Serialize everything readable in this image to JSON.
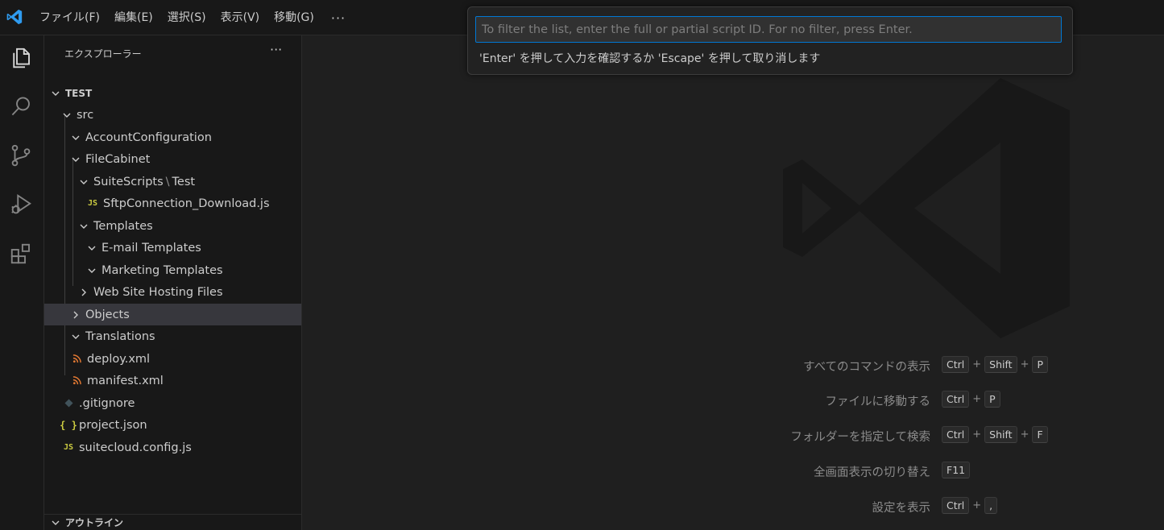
{
  "menu": {
    "items": [
      "ファイル(F)",
      "編集(E)",
      "選択(S)",
      "表示(V)",
      "移動(G)"
    ],
    "more": "···"
  },
  "sidebar": {
    "title": "エクスプローラー",
    "more": "···",
    "outline_title": "アウトライン",
    "tree": [
      {
        "label": "TEST",
        "kind": "root"
      },
      {
        "label": "src",
        "kind": "folder-open"
      },
      {
        "label": "AccountConfiguration",
        "kind": "folder-open"
      },
      {
        "label": "FileCabinet",
        "kind": "folder-open"
      },
      {
        "label": "SuiteScripts",
        "label2": "Test",
        "kind": "folder-open"
      },
      {
        "label": "SftpConnection_Download.js",
        "kind": "file-js",
        "icon_text": "JS"
      },
      {
        "label": "Templates",
        "kind": "folder-open"
      },
      {
        "label": "E-mail Templates",
        "kind": "folder-open"
      },
      {
        "label": "Marketing Templates",
        "kind": "folder-open"
      },
      {
        "label": "Web Site Hosting Files",
        "kind": "folder-closed"
      },
      {
        "label": "Objects",
        "kind": "folder-closed",
        "selected": true
      },
      {
        "label": "Translations",
        "kind": "folder-open"
      },
      {
        "label": "deploy.xml",
        "kind": "file-xml"
      },
      {
        "label": "manifest.xml",
        "kind": "file-xml"
      },
      {
        "label": ".gitignore",
        "kind": "file-git"
      },
      {
        "label": "project.json",
        "kind": "file-json",
        "icon_text": "{ }"
      },
      {
        "label": "suitecloud.config.js",
        "kind": "file-js",
        "icon_text": "JS"
      }
    ]
  },
  "quickinput": {
    "placeholder": "To filter the list, enter the full or partial script ID. For no filter, press Enter.",
    "message": "'Enter' を押して入力を確認するか 'Escape' を押して取り消します"
  },
  "shortcuts": [
    {
      "label": "すべてのコマンドの表示",
      "keys": [
        "Ctrl",
        "Shift",
        "P"
      ]
    },
    {
      "label": "ファイルに移動する",
      "keys": [
        "Ctrl",
        "P"
      ]
    },
    {
      "label": "フォルダーを指定して検索",
      "keys": [
        "Ctrl",
        "Shift",
        "F"
      ]
    },
    {
      "label": "全画面表示の切り替え",
      "keys": [
        "F11"
      ]
    },
    {
      "label": "設定を表示",
      "keys": [
        "Ctrl",
        ","
      ]
    }
  ],
  "colors": {
    "accent": "#0078d4",
    "js_icon": "#cbcb41",
    "xml_icon": "#e37933"
  }
}
